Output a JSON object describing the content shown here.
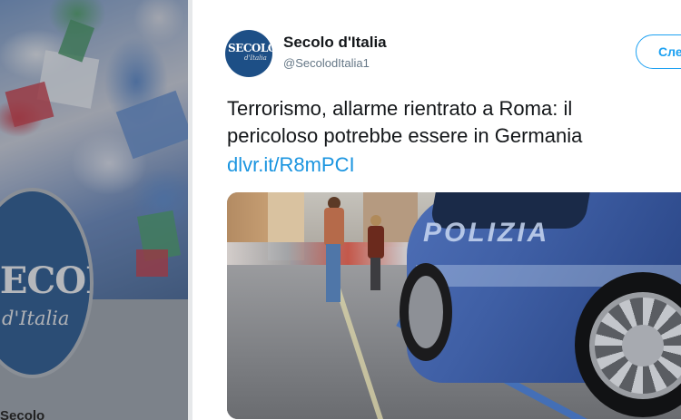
{
  "left_profile": {
    "logo_title": "SECOLO",
    "logo_subtitle": "d'Italia",
    "name_partial": "Secolo"
  },
  "tweet": {
    "display_name": "Secolo d'Italia",
    "handle": "@SecolodItalia1",
    "follow_label": "Следить",
    "text_line1": "Terrorismo, allarme rientrato a Roma: il",
    "text_line2": "pericoloso potrebbe essere in Germania",
    "link": "dlvr.it/R8mPCI",
    "avatar": {
      "title": "SECOLO",
      "subtitle": "d'Italia"
    },
    "photo": {
      "car_lettering": "POLIZIA"
    }
  },
  "colors": {
    "accent": "#1da1f2",
    "link": "#1b95e0",
    "brand_blue": "#1d4f86"
  }
}
